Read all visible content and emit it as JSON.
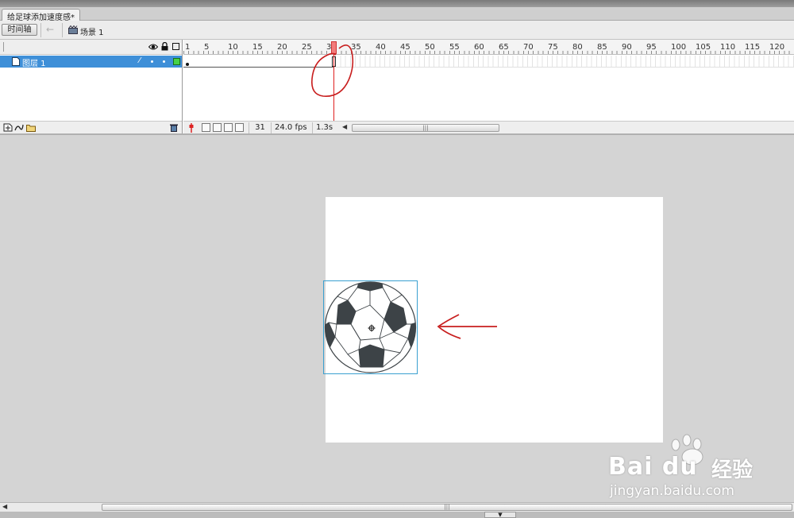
{
  "document": {
    "tab_title": "给足球添加速度感*"
  },
  "toolbar": {
    "timeline_button": "时间轴",
    "scene_label": "场景 1"
  },
  "layers": [
    {
      "name": "图层 1",
      "outline_color": "#47d147"
    }
  ],
  "ruler": {
    "labels": [
      "1",
      "5",
      "10",
      "15",
      "20",
      "25",
      "30",
      "35",
      "40",
      "45",
      "50",
      "55",
      "60",
      "65",
      "70",
      "75",
      "80",
      "85",
      "90",
      "95",
      "100",
      "105",
      "110",
      "115",
      "120"
    ]
  },
  "timeline_status": {
    "current_frame": "31",
    "frame_rate": "24.0 fps",
    "elapsed_time": "1.3s"
  },
  "colors": {
    "selection": "#3e8fd8",
    "playhead": "#e02020",
    "annotation": "#c81e1e",
    "ball_panels": "#3d4347",
    "bbox": "#3aa0d0"
  },
  "icons": [
    "eye-icon",
    "lock-icon",
    "outline-icon",
    "layer-icon",
    "pencil-icon",
    "new-layer-icon",
    "motion-guide-icon",
    "new-folder-icon",
    "trash-icon",
    "center-frame-icon",
    "onion-skin-icon",
    "onion-outline-icon",
    "edit-multiple-frames-icon",
    "onion-markers-icon"
  ],
  "watermark": {
    "brand": "Bai du",
    "cn": "经验",
    "url": "jingyan.baidu.com"
  }
}
